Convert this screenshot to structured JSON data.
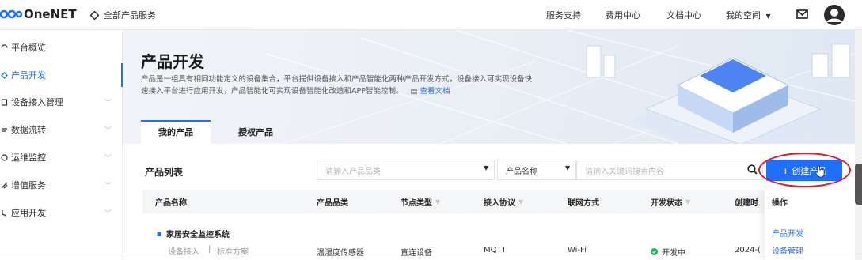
{
  "header": {
    "logo_text": "OneNET",
    "all_products": "全部产品服务",
    "nav": [
      "服务支持",
      "费用中心",
      "文档中心",
      "我的空间"
    ]
  },
  "sidebar": {
    "items": [
      {
        "label": "平台概览",
        "icon": "platform-overview-icon",
        "has_chevron": false
      },
      {
        "label": "产品开发",
        "icon": "product-dev-icon",
        "has_chevron": false,
        "active": true
      },
      {
        "label": "设备接入管理",
        "icon": "device-access-icon",
        "has_chevron": true
      },
      {
        "label": "数据流转",
        "icon": "data-flow-icon",
        "has_chevron": true
      },
      {
        "label": "运维监控",
        "icon": "ops-monitor-icon",
        "has_chevron": true
      },
      {
        "label": "增值服务",
        "icon": "value-added-icon",
        "has_chevron": true
      },
      {
        "label": "应用开发",
        "icon": "app-dev-icon",
        "has_chevron": true
      }
    ]
  },
  "banner": {
    "title": "产品开发",
    "desc_line1": "产品是一组具有相同功能定义的设备集合，平台提供设备接入和产品智能化两种产品开发方式，设备接入可实现设备快",
    "desc_line2": "速接入平台进行应用开发，产品智能化可实现设备智能化改造和APP智能控制。",
    "doc_link": "查看文档"
  },
  "tabs": [
    "我的产品",
    "授权产品"
  ],
  "list": {
    "title": "产品列表",
    "category_placeholder": "请输入产品品类",
    "name_filter": "产品名称",
    "keyword_placeholder": "请输入关键词搜索内容",
    "create_button": "+ 创建产品"
  },
  "table": {
    "headers": [
      "产品名称",
      "产品品类",
      "节点类型",
      "接入协议",
      "联网方式",
      "开发状态",
      "创建时",
      "操作"
    ],
    "rows": [
      {
        "name": "家居安全监控系统",
        "sub_access": "设备接入",
        "sub_sep": "|",
        "sub_plan": "标准方案",
        "category": "温湿度传感器",
        "node_type": "直连设备",
        "protocol": "MQTT",
        "network": "Wi-Fi",
        "status": "开发中",
        "created": "2024-(",
        "ops": [
          "产品开发",
          "设备管理"
        ]
      }
    ]
  },
  "colors": {
    "accent": "#1f6fff",
    "status_green": "#19b35c",
    "highlight": "#e01b24"
  }
}
